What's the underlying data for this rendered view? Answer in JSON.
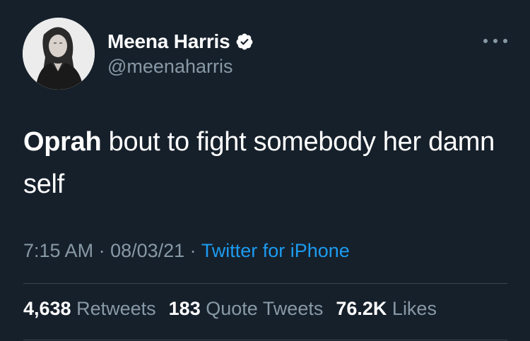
{
  "author": {
    "display_name": "Meena Harris",
    "handle": "@meenaharris",
    "verified": true,
    "avatar_icon": "profile-photo"
  },
  "tweet": {
    "bold_text": "Oprah",
    "body_text": " bout to fight somebody her damn self"
  },
  "meta": {
    "time": "7:15 AM",
    "separator1": " · ",
    "date": "08/03/21",
    "separator2": " · ",
    "source": "Twitter for iPhone"
  },
  "stats": {
    "retweets_count": "4,638",
    "retweets_label": "Retweets",
    "quotes_count": "183",
    "quotes_label": "Quote Tweets",
    "likes_count": "76.2K",
    "likes_label": "Likes"
  },
  "colors": {
    "background": "#16202b",
    "secondary_text": "#8899a6",
    "link": "#1d9bf0",
    "divider": "#38444d"
  }
}
